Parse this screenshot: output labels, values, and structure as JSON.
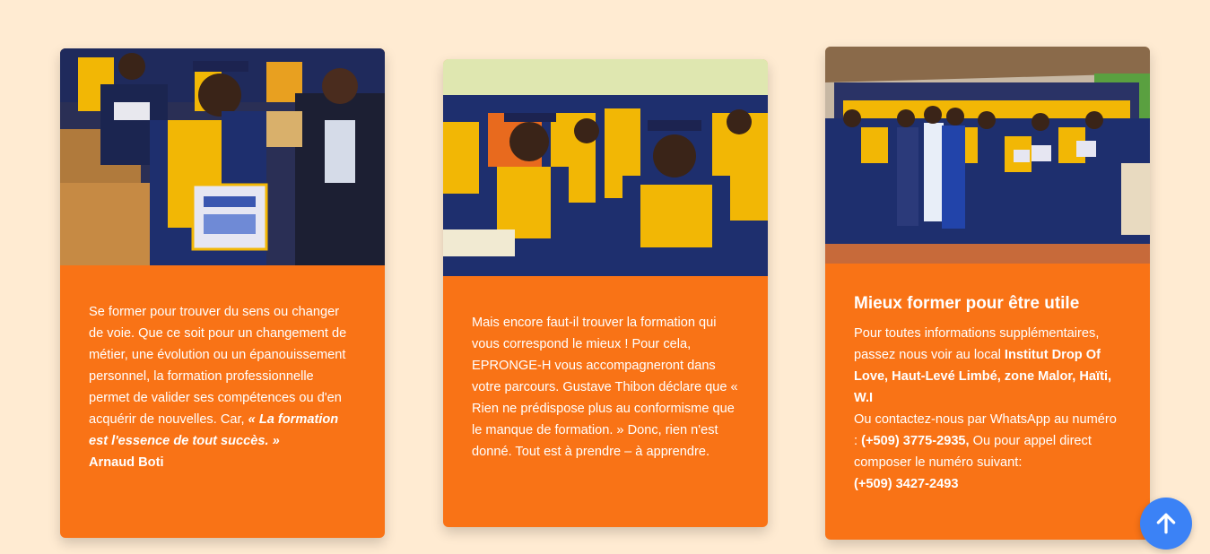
{
  "cards": [
    {
      "photo_alt": "Graduates in blue and gold gowns holding a diploma",
      "text_before": "Se former pour trouver du sens ou changer de voie. Que ce soit pour un changement de métier, une évolution ou un épanouissement personnel, la formation professionnelle permet de valider ses compétences ou d'en acquérir de nouvelles. Car, ",
      "quote": "« La formation est l'essence de tout succès. »",
      "author": "Arnaud Boti"
    },
    {
      "photo_alt": "Graduates seated in blue gowns and caps",
      "text": "Mais encore faut-il trouver la formation qui vous correspond le mieux ! Pour cela, EPRONGE-H vous accompagneront dans votre parcours. Gustave Thibon déclare que « Rien ne prédispose plus au conformisme que le manque de formation. » Donc, rien n'est donné. Tout est à prendre – à apprendre."
    },
    {
      "photo_alt": "Group photo of graduates and staff",
      "title": "Mieux former pour être utile",
      "text1": "Pour toutes informations supplémentaires, passez nous voir au local ",
      "location": "Institut Drop Of Love, Haut-Levé Limbé, zone Malor, Haïti, W.I",
      "text2": "Ou contactez-nous par WhatsApp au numéro : ",
      "whatsapp": "(+509) 3775-2935,",
      "text3": " Ou pour appel direct composer le numéro suivant:",
      "phone": "(+509) 3427-2493"
    }
  ],
  "scroll_top": {
    "icon": "arrow-up-icon",
    "color": "#3b82f6"
  },
  "colors": {
    "background": "#ffebd2",
    "card": "#f97316",
    "gown_blue": "#1e2f6e",
    "gown_gold": "#f2b705"
  }
}
